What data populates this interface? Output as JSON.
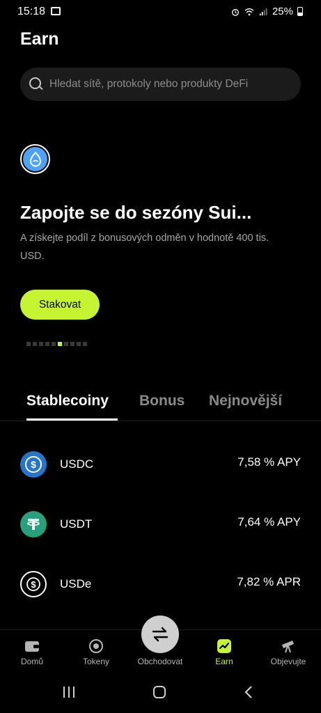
{
  "status_bar": {
    "time": "15:18",
    "battery": "25%"
  },
  "page": {
    "title": "Earn"
  },
  "search": {
    "placeholder": "Hledat sítě, protokoly nebo produkty DeFi"
  },
  "promo": {
    "title": "Zapojte se do sezóny Sui...",
    "subtitle": "A získejte podíl z bonusových odměn v hodnotě 400 tis. USD.",
    "cta_label": "Stakovat",
    "pager": {
      "total": 10,
      "active_index": 5
    }
  },
  "tabs": [
    {
      "label": "Stablecoiny",
      "active": true
    },
    {
      "label": "Bonus",
      "active": false
    },
    {
      "label": "Nejnovější",
      "active": false
    }
  ],
  "assets": [
    {
      "name": "USDC",
      "rate": "7,58 % APY",
      "icon": "usdc-icon",
      "color": "#2775ca"
    },
    {
      "name": "USDT",
      "rate": "7,64 % APY",
      "icon": "usdt-icon",
      "color": "#26a17b"
    },
    {
      "name": "USDe",
      "rate": "7,82 % APR",
      "icon": "usde-icon",
      "color": "#000000"
    }
  ],
  "bottom_nav": [
    {
      "label": "Domů",
      "icon": "wallet-icon"
    },
    {
      "label": "Tokeny",
      "icon": "tokens-icon"
    },
    {
      "label": "Obchodovat",
      "icon": "swap-icon"
    },
    {
      "label": "Earn",
      "icon": "earn-icon",
      "active": true
    },
    {
      "label": "Objevujte",
      "icon": "telescope-icon"
    }
  ],
  "colors": {
    "accent": "#c6f432",
    "background": "#000000",
    "search_bg": "#1b1b1b"
  }
}
